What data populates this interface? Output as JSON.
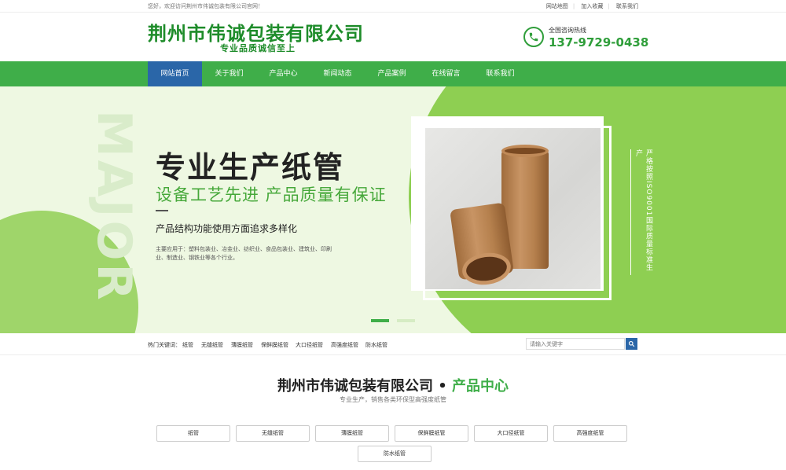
{
  "topbar": {
    "welcome": "您好，欢迎访问荆州市伟诚包装有限公司官网！",
    "links": [
      "网站地图",
      "加入收藏",
      "联系我们"
    ]
  },
  "header": {
    "company": "荆州市伟诚包装有限公司",
    "slogan": "专业品质诚信至上",
    "hotline_label": "全国咨询热线",
    "hotline_number": "137-9729-0438"
  },
  "nav": {
    "items": [
      "网站首页",
      "关于我们",
      "产品中心",
      "新闻动态",
      "产品案例",
      "在线留言",
      "联系我们"
    ],
    "active_index": 0
  },
  "banner": {
    "watermark": "MAJOR",
    "title": "专业生产纸管",
    "subtitle": "设备工艺先进  产品质量有保证",
    "desc": "产品结构功能使用方面追求多样化",
    "note": "主要应用于：塑料包装业、冶金业、纺织业、食品包装业、建筑业、印刷业、制造业、钢铁业等各个行业。",
    "vertical_text": "严格按照ISO9001国际质量标准生产",
    "slide_current": 1,
    "slide_total": 2
  },
  "keywords": {
    "label": "热门关键词：",
    "items": [
      "纸管",
      "无缝纸管",
      "薄膜纸管",
      "保鲜膜纸管",
      "大口径纸管",
      "高强度纸管",
      "防水纸管"
    ]
  },
  "search": {
    "placeholder": "请输入关键字"
  },
  "products": {
    "title_main": "荆州市伟诚包装有限公司",
    "title_dot": " • ",
    "title_accent": "产品中心",
    "subtitle": "专业生产，销售各类环保型高强度纸管",
    "categories": [
      "纸管",
      "无缝纸管",
      "薄膜纸管",
      "保鲜膜纸管",
      "大口径纸管",
      "高强度纸管",
      "防水纸管"
    ]
  },
  "colors": {
    "brand_green": "#3fae49",
    "nav_active": "#2a66a8",
    "banner_bg": "#eef8e2"
  }
}
